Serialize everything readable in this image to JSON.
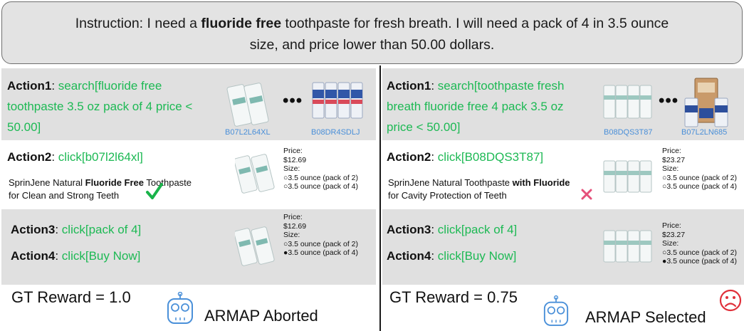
{
  "instruction": {
    "prefix": "Instruction: I need a ",
    "bold": "fluoride free",
    "line1_rest": " toothpaste for fresh breath. I will need a pack of 4 in 3.5 ounce",
    "line2": "size, and price lower than 50.00 dollars."
  },
  "left": {
    "action1": {
      "label": "Action1",
      "cmd_lines": [
        "search[fluoride free",
        "toothpaste 3.5 oz pack of 4 price <",
        "50.00]"
      ]
    },
    "asins": [
      "B07L2L64XL",
      "B08DR4SDLJ"
    ],
    "dots": "•••",
    "action2": {
      "label": "Action2",
      "cmd": "click[b07l2l64xl]"
    },
    "product": {
      "pre": "SprinJene Natural ",
      "bold": "Fluoride Free",
      "post": " Toothpaste",
      "line2": "for Clean and Strong Teeth"
    },
    "verdict": "correct-check",
    "price_label": "Price:",
    "price": "$12.69",
    "size_label": "Size:",
    "size_options": [
      "3.5 ounce (pack of 2)",
      "3.5 ounce (pack of 4)"
    ],
    "action3": {
      "label": "Action3",
      "cmd": "click[pack of 4]"
    },
    "action4": {
      "label": "Action4",
      "cmd": "click[Buy Now]"
    },
    "selected_option": "3.5 ounce (pack of 4)",
    "reward": "GT Reward = 1.0",
    "armap": "ARMAP Aborted"
  },
  "right": {
    "action1": {
      "label": "Action1",
      "cmd_lines": [
        "search[toothpaste fresh",
        "breath fluoride free 4 pack 3.5 oz",
        "price < 50.00]"
      ]
    },
    "asins": [
      "B08DQS3T87",
      "B07L2LN685"
    ],
    "dots": "•••",
    "action2": {
      "label": "Action2",
      "cmd": "click[B08DQS3T87]"
    },
    "product": {
      "pre": "SprinJene Natural Toothpaste ",
      "bold": "with Fluoride",
      "post": "",
      "line2": "for Cavity Protection of Teeth"
    },
    "verdict": "wrong-cross",
    "price_label": "Price:",
    "price": "$23.27",
    "size_label": "Size:",
    "size_options": [
      "3.5 ounce (pack of 2)",
      "3.5 ounce (pack of 4)"
    ],
    "action3": {
      "label": "Action3",
      "cmd": "click[pack of 4]"
    },
    "action4": {
      "label": "Action4",
      "cmd": "click[Buy Now]"
    },
    "selected_option": "3.5 ounce (pack of 4)",
    "reward": "GT Reward = 0.75",
    "armap": "ARMAP Selected",
    "mood": "sad-face-icon"
  },
  "colors": {
    "action_cmd": "#1db954",
    "asin": "#4a8fd8",
    "check": "#19b34a",
    "cross": "#e5507a",
    "sad": "#e0303a",
    "robot": "#4a90d9"
  }
}
